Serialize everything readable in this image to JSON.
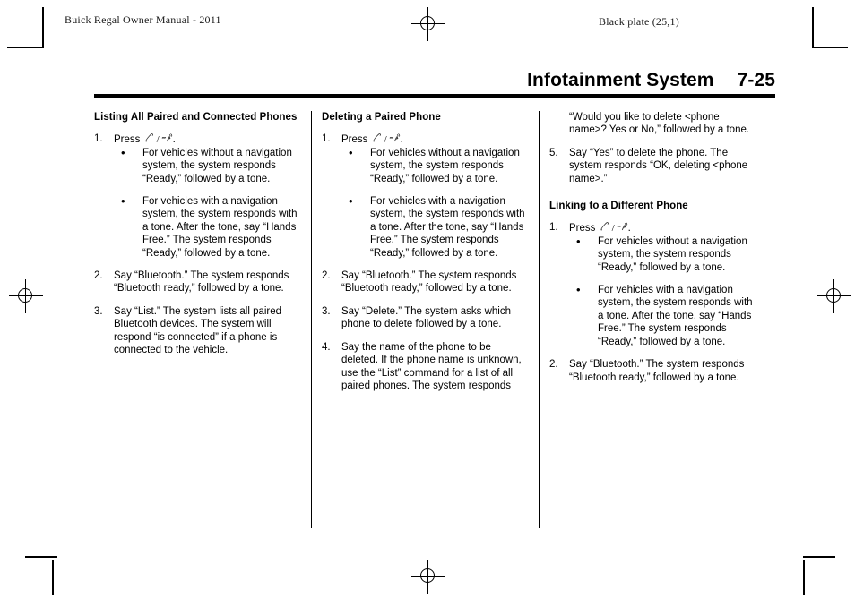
{
  "header": {
    "left": "Buick Regal Owner Manual - 2011",
    "right": "Black plate (25,1)"
  },
  "title": {
    "section": "Infotainment System",
    "page_number": "7-25"
  },
  "icons": {
    "phone": "phone-handset-icon",
    "voice": "voice-recognition-icon",
    "separator": "/",
    "registration_mark": "registration-crosshair-mark",
    "crop_mark": "crop-mark"
  },
  "columns": [
    {
      "heading": "Listing All Paired and Connected Phones",
      "blocks": [
        {
          "type": "step",
          "number": "1.",
          "text_before_icons": "Press",
          "text_after_icons": ".",
          "bullets": [
            "For vehicles without a navigation system, the system responds “Ready,” followed by a tone.",
            "For vehicles with a navigation system, the system responds with a tone. After the tone, say “Hands Free.” The system responds “Ready,” followed by a tone."
          ]
        },
        {
          "type": "step",
          "number": "2.",
          "text": "Say “Bluetooth.” The system responds “Bluetooth ready,” followed by a tone."
        },
        {
          "type": "step",
          "number": "3.",
          "text": "Say “List.” The system lists all paired Bluetooth devices. The system will respond “is connected” if a phone is connected to the vehicle."
        }
      ]
    },
    {
      "heading": "Deleting a Paired Phone",
      "blocks": [
        {
          "type": "step",
          "number": "1.",
          "text_before_icons": "Press",
          "text_after_icons": ".",
          "bullets": [
            "For vehicles without a navigation system, the system responds “Ready,” followed by a tone.",
            "For vehicles with a navigation system, the system responds with a tone. After the tone, say “Hands Free.” The system responds “Ready,” followed by a tone."
          ]
        },
        {
          "type": "step",
          "number": "2.",
          "text": "Say “Bluetooth.” The system responds “Bluetooth ready,” followed by a tone."
        },
        {
          "type": "step",
          "number": "3.",
          "text": "Say “Delete.” The system asks which phone to delete followed by a tone."
        },
        {
          "type": "step",
          "number": "4.",
          "text": "Say the name of the phone to be deleted. If the phone name is unknown, use the “List” command for a list of all paired phones. The system responds"
        }
      ]
    },
    {
      "heading": "Linking to a Different Phone",
      "continuation": "“Would you like to delete <phone name>? Yes or No,” followed by a tone.",
      "blocks": [
        {
          "type": "step",
          "number": "5.",
          "text": "Say “Yes” to delete the phone. The system responds “OK, deleting <phone name>.”"
        },
        {
          "type": "step",
          "number": "1.",
          "text_before_icons": "Press",
          "text_after_icons": ".",
          "bullets": [
            "For vehicles without a navigation system, the system responds “Ready,” followed by a tone.",
            "For vehicles with a navigation system, the system responds with a tone. After the tone, say “Hands Free.” The system responds “Ready,” followed by a tone."
          ]
        },
        {
          "type": "step",
          "number": "2.",
          "text": "Say “Bluetooth.” The system responds “Bluetooth ready,” followed by a tone."
        }
      ]
    }
  ]
}
